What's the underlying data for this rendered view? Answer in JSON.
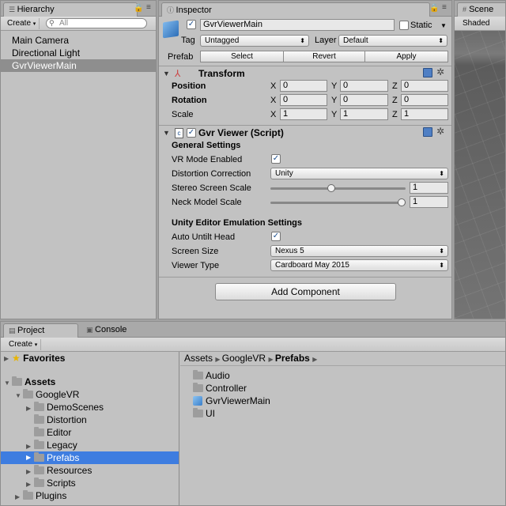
{
  "hierarchy": {
    "tab_label": "Hierarchy",
    "create_label": "Create",
    "search_placeholder": "All",
    "items": [
      {
        "label": "Main Camera"
      },
      {
        "label": "Directional Light"
      },
      {
        "label": "GvrViewerMain",
        "selected": true
      }
    ]
  },
  "inspector": {
    "tab_label": "Inspector",
    "object_name": "GvrViewerMain",
    "active_checked": true,
    "static_label": "Static",
    "tag_label": "Tag",
    "tag_value": "Untagged",
    "layer_label": "Layer",
    "layer_value": "Default",
    "prefab_label": "Prefab",
    "prefab_buttons": [
      "Select",
      "Revert",
      "Apply"
    ],
    "transform": {
      "title": "Transform",
      "rows": [
        {
          "label": "Position",
          "bold": true,
          "x": "0",
          "y": "0",
          "z": "0"
        },
        {
          "label": "Rotation",
          "bold": true,
          "x": "0",
          "y": "0",
          "z": "0"
        },
        {
          "label": "Scale",
          "bold": false,
          "x": "1",
          "y": "1",
          "z": "1"
        }
      ],
      "axes": [
        "X",
        "Y",
        "Z"
      ]
    },
    "gvr": {
      "title": "Gvr Viewer (Script)",
      "general_settings": "General Settings",
      "vr_mode_label": "VR Mode Enabled",
      "vr_mode": true,
      "distortion_label": "Distortion Correction",
      "distortion_value": "Unity",
      "stereo_label": "Stereo Screen Scale",
      "stereo_value": "1",
      "stereo_fraction": 0.45,
      "neck_label": "Neck Model Scale",
      "neck_value": "1",
      "neck_fraction": 1.0,
      "emulation_settings": "Unity Editor Emulation Settings",
      "auto_untilt_label": "Auto Untilt Head",
      "auto_untilt": true,
      "screen_size_label": "Screen Size",
      "screen_size_value": "Nexus 5",
      "viewer_type_label": "Viewer Type",
      "viewer_type_value": "Cardboard May 2015"
    },
    "add_component": "Add Component"
  },
  "scene": {
    "tab_label": "Scene",
    "shading": "Shaded"
  },
  "project": {
    "tab_label": "Project",
    "console_tab_label": "Console",
    "create_label": "Create",
    "favorites": "Favorites",
    "tree": [
      {
        "label": "Assets",
        "level": 0,
        "bold": true
      },
      {
        "label": "GoogleVR",
        "level": 1
      },
      {
        "label": "DemoScenes",
        "level": 2
      },
      {
        "label": "Distortion",
        "level": 2
      },
      {
        "label": "Editor",
        "level": 2
      },
      {
        "label": "Legacy",
        "level": 2
      },
      {
        "label": "Prefabs",
        "level": 2,
        "selected": true
      },
      {
        "label": "Resources",
        "level": 2
      },
      {
        "label": "Scripts",
        "level": 2
      },
      {
        "label": "Plugins",
        "level": 1
      }
    ],
    "breadcrumb": [
      "Assets",
      "GoogleVR",
      "Prefabs"
    ],
    "contents": [
      {
        "label": "Audio",
        "icon": "folder-icon"
      },
      {
        "label": "Controller",
        "icon": "folder-icon"
      },
      {
        "label": "GvrViewerMain",
        "icon": "prefab-cube-icon"
      },
      {
        "label": "UI",
        "icon": "folder-icon"
      }
    ]
  },
  "colors": {
    "selection_blue": "#3e7de0",
    "panel_bg": "#c2c2c2",
    "prefab_blue": "#4a90d9"
  }
}
